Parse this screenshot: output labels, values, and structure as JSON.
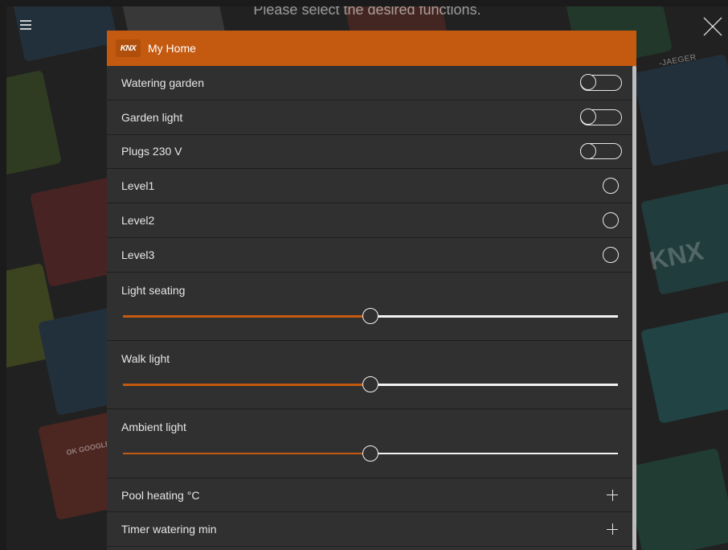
{
  "background": {
    "prompt": "Please select the desired functions.",
    "brand_text": "-JAEGER",
    "knx_text": "KNX",
    "google_text": "OK GOOGLE."
  },
  "panel": {
    "logo": "KNX",
    "title": "My Home",
    "accent_color": "#c45a10",
    "rows": [
      {
        "label": "Watering garden",
        "control": "toggle",
        "state": "off"
      },
      {
        "label": "Garden light",
        "control": "toggle",
        "state": "off"
      },
      {
        "label": "Plugs 230 V",
        "control": "toggle",
        "state": "off"
      },
      {
        "label": "Level1",
        "control": "radio",
        "state": "unselected"
      },
      {
        "label": "Level2",
        "control": "radio",
        "state": "unselected"
      },
      {
        "label": "Level3",
        "control": "radio",
        "state": "unselected"
      },
      {
        "label": "Light seating",
        "control": "slider",
        "value": 0.5
      },
      {
        "label": "Walk light",
        "control": "slider",
        "value": 0.5
      },
      {
        "label": "Ambient light",
        "control": "slider",
        "value": 0.5
      },
      {
        "label": "Pool heating °C",
        "control": "stepper",
        "icon": "plus-icon"
      },
      {
        "label": "Timer watering min",
        "control": "stepper",
        "icon": "plus-icon"
      }
    ]
  },
  "icons": {
    "menu": "hamburger-menu-icon",
    "close": "close-icon"
  }
}
